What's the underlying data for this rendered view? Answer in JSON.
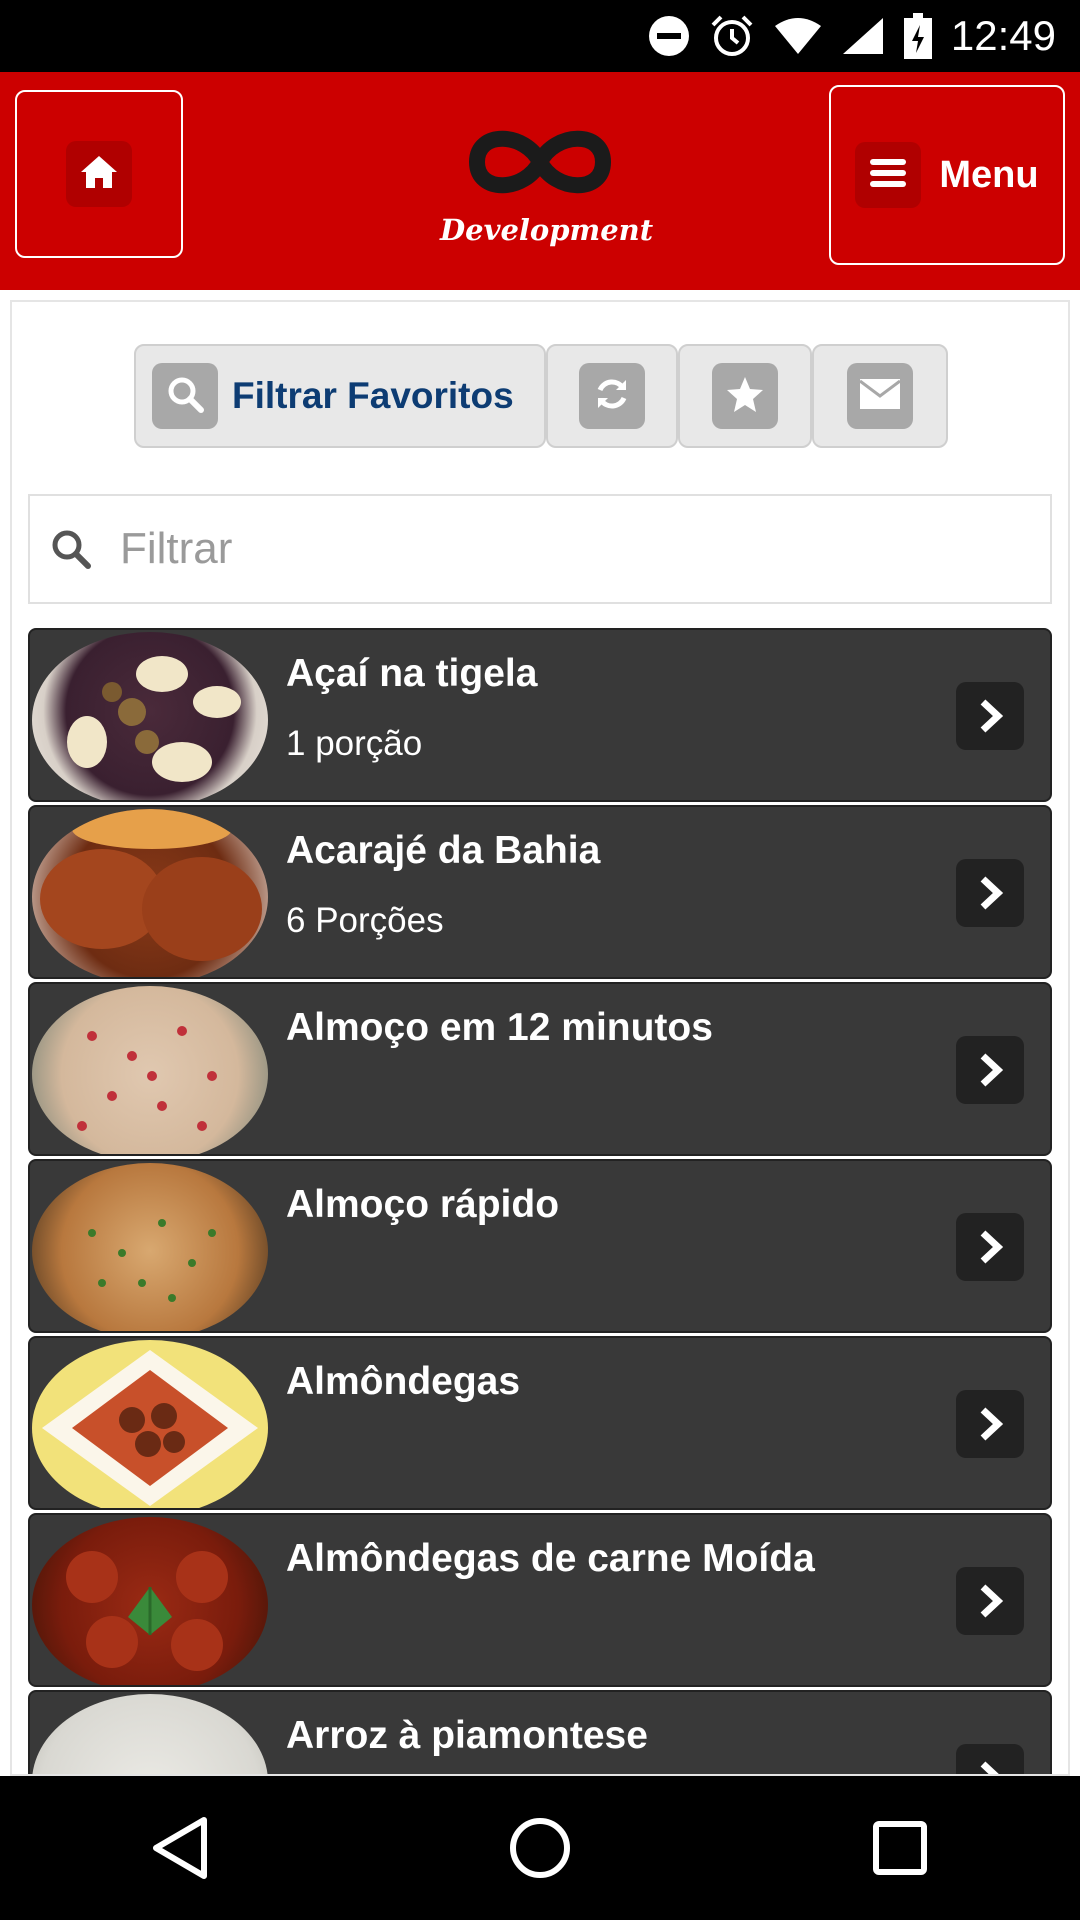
{
  "status_bar": {
    "time": "12:49"
  },
  "header": {
    "logo_text": "Development",
    "menu_label": "Menu",
    "home_icon": "home-icon",
    "menu_icon": "hamburger-icon"
  },
  "toolbar": {
    "filter_favorites_label": "Filtrar Favoritos",
    "icons": [
      "search-icon",
      "refresh-icon",
      "star-icon",
      "envelope-icon"
    ]
  },
  "search": {
    "placeholder": "Filtrar",
    "value": ""
  },
  "recipes": [
    {
      "title": "Açaí na tigela",
      "subtitle": "1 porção"
    },
    {
      "title": "Acarajé da Bahia",
      "subtitle": "6 Porções"
    },
    {
      "title": "Almoço em 12 minutos",
      "subtitle": ""
    },
    {
      "title": "Almoço rápido",
      "subtitle": ""
    },
    {
      "title": "Almôndegas",
      "subtitle": ""
    },
    {
      "title": "Almôndegas de carne Moída",
      "subtitle": ""
    },
    {
      "title": "Arroz à piamontese",
      "subtitle": ""
    }
  ],
  "colors": {
    "header_red": "#cc0000",
    "list_item_bg": "#393939",
    "filter_label": "#0d3c73"
  }
}
